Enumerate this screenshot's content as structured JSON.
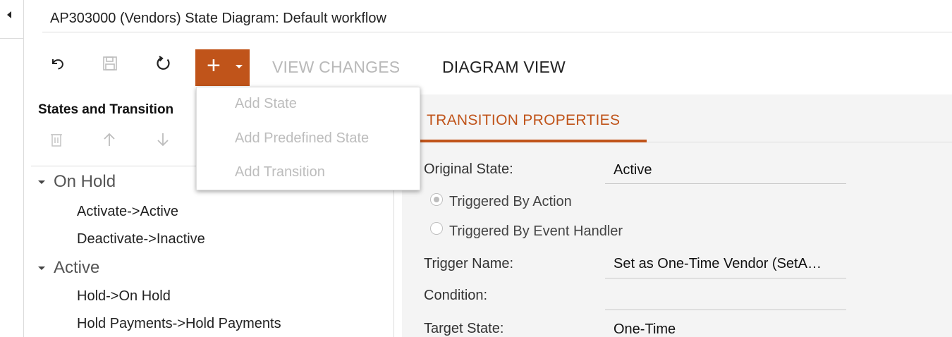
{
  "window": {
    "title": "AP303000 (Vendors) State Diagram: Default workflow"
  },
  "toolbar": {
    "undo_icon": "undo-icon",
    "save_icon": "save-icon",
    "refresh_icon": "refresh-icon",
    "add_icon": "plus-icon",
    "view_changes_label": "VIEW CHANGES",
    "diagram_view_label": "DIAGRAM VIEW",
    "accent_color": "#c0541a"
  },
  "add_menu": {
    "items": [
      {
        "label": "Add State",
        "enabled": false
      },
      {
        "label": "Add Predefined State",
        "enabled": false
      },
      {
        "label": "Add Transition",
        "enabled": false
      }
    ]
  },
  "left_panel": {
    "header": "States and Transition",
    "tools": [
      "trash-icon",
      "arrow-up-icon",
      "arrow-down-icon"
    ],
    "tree": [
      {
        "state": "On Hold",
        "transitions": [
          "Activate->Active",
          "Deactivate->Inactive"
        ]
      },
      {
        "state": "Active",
        "transitions": [
          "Hold->On Hold",
          "Hold Payments->Hold Payments"
        ]
      }
    ]
  },
  "right_panel": {
    "tab_label": "TRANSITION PROPERTIES",
    "original_state_label": "Original State:",
    "original_state_value": "Active",
    "radio_action_label": "Triggered By Action",
    "radio_action_checked": true,
    "radio_event_label": "Triggered By Event Handler",
    "radio_event_checked": false,
    "trigger_name_label": "Trigger Name:",
    "trigger_name_value": "Set as One-Time Vendor (SetA…",
    "condition_label": "Condition:",
    "condition_value": "",
    "target_state_label": "Target State:",
    "target_state_value": "One-Time"
  }
}
